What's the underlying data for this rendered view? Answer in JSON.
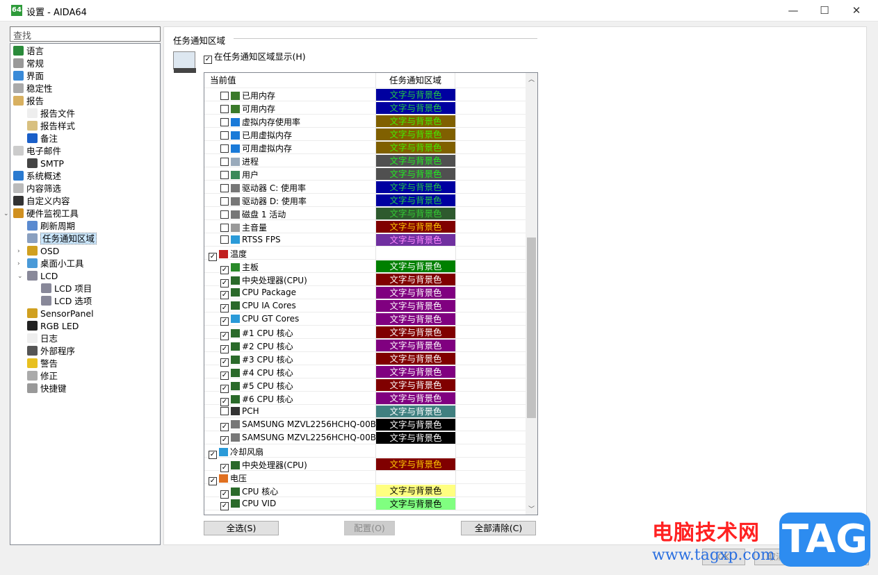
{
  "window": {
    "title": "设置 - AIDA64",
    "app_icon": "64",
    "minimize": "—",
    "maximize": "☐",
    "close": "✕"
  },
  "sidebar": {
    "search_placeholder": "查找",
    "items": [
      {
        "label": "语言",
        "level": 0,
        "icon": "globe-icon",
        "color": "#2a8a3a"
      },
      {
        "label": "常规",
        "level": 0,
        "icon": "gear-icon",
        "color": "#999"
      },
      {
        "label": "界面",
        "level": 0,
        "icon": "window-icon",
        "color": "#3a8ad8"
      },
      {
        "label": "稳定性",
        "level": 0,
        "icon": "gears-icon",
        "color": "#aaa"
      },
      {
        "label": "报告",
        "level": 0,
        "icon": "report-icon",
        "color": "#d8b060"
      },
      {
        "label": "报告文件",
        "level": 1,
        "icon": "file-icon",
        "color": "#eee"
      },
      {
        "label": "报告样式",
        "level": 1,
        "icon": "edit-icon",
        "color": "#d8c080"
      },
      {
        "label": "备注",
        "level": 1,
        "icon": "info-icon",
        "color": "#1a5fc8"
      },
      {
        "label": "电子邮件",
        "level": 0,
        "icon": "mail-icon",
        "color": "#ccc"
      },
      {
        "label": "SMTP",
        "level": 1,
        "icon": "phone-icon",
        "color": "#444"
      },
      {
        "label": "系统概述",
        "level": 0,
        "icon": "monitor-icon",
        "color": "#2a7ad0"
      },
      {
        "label": "内容筛选",
        "level": 0,
        "icon": "filter-icon",
        "color": "#bbb"
      },
      {
        "label": "自定义内容",
        "level": 0,
        "icon": "phone-icon",
        "color": "#333"
      },
      {
        "label": "硬件监视工具",
        "level": 0,
        "icon": "gauge-icon",
        "color": "#d09020",
        "expander": "⌄"
      },
      {
        "label": "刷新周期",
        "level": 1,
        "icon": "clock-icon",
        "color": "#5a8ad0"
      },
      {
        "label": "任务通知区域",
        "level": 1,
        "icon": "tray-icon",
        "color": "#8aa0c0",
        "selected": true
      },
      {
        "label": "OSD",
        "level": 1,
        "icon": "gauge-icon",
        "color": "#d0a020",
        "expander": "›"
      },
      {
        "label": "桌面小工具",
        "level": 1,
        "icon": "gadget-icon",
        "color": "#4a9ad8",
        "expander": "›"
      },
      {
        "label": "LCD",
        "level": 1,
        "icon": "lcd-icon",
        "color": "#889",
        "expander": "⌄"
      },
      {
        "label": "LCD 项目",
        "level": 2,
        "icon": "lcd-icon",
        "color": "#889"
      },
      {
        "label": "LCD 选项",
        "level": 2,
        "icon": "lcd-icon",
        "color": "#889"
      },
      {
        "label": "SensorPanel",
        "level": 1,
        "icon": "gauge-icon",
        "color": "#d0a020"
      },
      {
        "label": "RGB LED",
        "level": 1,
        "icon": "rgb-icon",
        "color": "#222"
      },
      {
        "label": "日志",
        "level": 1,
        "icon": "log-icon",
        "color": "#eee"
      },
      {
        "label": "外部程序",
        "level": 1,
        "icon": "program-icon",
        "color": "#555"
      },
      {
        "label": "警告",
        "level": 1,
        "icon": "warning-icon",
        "color": "#e8c020"
      },
      {
        "label": "修正",
        "level": 1,
        "icon": "correct-icon",
        "color": "#aaa"
      },
      {
        "label": "快捷键",
        "level": 1,
        "icon": "keyboard-icon",
        "color": "#999"
      }
    ]
  },
  "panel": {
    "group_title": "任务通知区域",
    "show_checkbox": {
      "label": "在任务通知区域显示(H)",
      "checked": true
    },
    "columns": [
      "当前值",
      "任务通知区域"
    ],
    "rows": [
      {
        "label": "已用内存",
        "level": 1,
        "checked": false,
        "icon": "memory-icon",
        "icolor": "#3a7a2a",
        "cell": "文字与背景色",
        "bg": "#0000a0",
        "fg": "#22cc44"
      },
      {
        "label": "可用内存",
        "level": 1,
        "checked": false,
        "icon": "memory-icon",
        "icolor": "#3a7a2a",
        "cell": "文字与背景色",
        "bg": "#0000a0",
        "fg": "#22cc44"
      },
      {
        "label": "虚拟内存使用率",
        "level": 1,
        "checked": false,
        "icon": "windows-icon",
        "icolor": "#1a7ad8",
        "cell": "文字与背景色",
        "bg": "#806000",
        "fg": "#44ee00"
      },
      {
        "label": "已用虚拟内存",
        "level": 1,
        "checked": false,
        "icon": "windows-icon",
        "icolor": "#1a7ad8",
        "cell": "文字与背景色",
        "bg": "#806000",
        "fg": "#44ee00"
      },
      {
        "label": "可用虚拟内存",
        "level": 1,
        "checked": false,
        "icon": "windows-icon",
        "icolor": "#1a7ad8",
        "cell": "文字与背景色",
        "bg": "#806000",
        "fg": "#44ee00"
      },
      {
        "label": "进程",
        "level": 1,
        "checked": false,
        "icon": "process-icon",
        "icolor": "#9ab",
        "cell": "文字与背景色",
        "bg": "#505050",
        "fg": "#22ee22"
      },
      {
        "label": "用户",
        "level": 1,
        "checked": false,
        "icon": "user-icon",
        "icolor": "#3a8a5a",
        "cell": "文字与背景色",
        "bg": "#505050",
        "fg": "#22ee22"
      },
      {
        "label": "驱动器 C: 使用率",
        "level": 1,
        "checked": false,
        "icon": "drive-icon",
        "icolor": "#777",
        "cell": "文字与背景色",
        "bg": "#0000a0",
        "fg": "#22cc44"
      },
      {
        "label": "驱动器 D: 使用率",
        "level": 1,
        "checked": false,
        "icon": "drive-icon",
        "icolor": "#777",
        "cell": "文字与背景色",
        "bg": "#0000a0",
        "fg": "#22cc44"
      },
      {
        "label": "磁盘 1 活动",
        "level": 1,
        "checked": false,
        "icon": "drive-icon",
        "icolor": "#777",
        "cell": "文字与背景色",
        "bg": "#2e5a2e",
        "fg": "#33cc33"
      },
      {
        "label": "主音量",
        "level": 1,
        "checked": false,
        "icon": "speaker-icon",
        "icolor": "#999",
        "cell": "文字与背景色",
        "bg": "#800000",
        "fg": "#ffcc00"
      },
      {
        "label": "RTSS FPS",
        "level": 1,
        "checked": false,
        "icon": "monitor-icon",
        "icolor": "#2a9ad8",
        "cell": "文字与背景色",
        "bg": "#7030a0",
        "fg": "#ff88ff"
      },
      {
        "label": "温度",
        "level": 0,
        "checked": true,
        "icon": "thermometer-icon",
        "icolor": "#c02020"
      },
      {
        "label": "主板",
        "level": 1,
        "checked": true,
        "icon": "motherboard-icon",
        "icolor": "#2a8a2a",
        "cell": "文字与背景色",
        "bg": "#008000",
        "fg": "#ffffff"
      },
      {
        "label": "中央处理器(CPU)",
        "level": 1,
        "checked": true,
        "icon": "cpu-icon",
        "icolor": "#2a6a2a",
        "cell": "文字与背景色",
        "bg": "#800000",
        "fg": "#ffffff"
      },
      {
        "label": "CPU Package",
        "level": 1,
        "checked": true,
        "icon": "cpu-icon",
        "icolor": "#2a6a2a",
        "cell": "文字与背景色",
        "bg": "#800080",
        "fg": "#ffffff"
      },
      {
        "label": "CPU IA Cores",
        "level": 1,
        "checked": true,
        "icon": "cpu-icon",
        "icolor": "#2a6a2a",
        "cell": "文字与背景色",
        "bg": "#800080",
        "fg": "#ffffff"
      },
      {
        "label": "CPU GT Cores",
        "level": 1,
        "checked": true,
        "icon": "gpu-icon",
        "icolor": "#2a9ad8",
        "cell": "文字与背景色",
        "bg": "#800080",
        "fg": "#ffffff"
      },
      {
        "label": "#1 CPU 核心",
        "level": 1,
        "checked": true,
        "icon": "cpu-icon",
        "icolor": "#2a6a2a",
        "cell": "文字与背景色",
        "bg": "#800000",
        "fg": "#ffffff"
      },
      {
        "label": "#2 CPU 核心",
        "level": 1,
        "checked": true,
        "icon": "cpu-icon",
        "icolor": "#2a6a2a",
        "cell": "文字与背景色",
        "bg": "#800080",
        "fg": "#ffffff"
      },
      {
        "label": "#3 CPU 核心",
        "level": 1,
        "checked": true,
        "icon": "cpu-icon",
        "icolor": "#2a6a2a",
        "cell": "文字与背景色",
        "bg": "#800000",
        "fg": "#ffffff"
      },
      {
        "label": "#4 CPU 核心",
        "level": 1,
        "checked": true,
        "icon": "cpu-icon",
        "icolor": "#2a6a2a",
        "cell": "文字与背景色",
        "bg": "#800080",
        "fg": "#ffffff"
      },
      {
        "label": "#5 CPU 核心",
        "level": 1,
        "checked": true,
        "icon": "cpu-icon",
        "icolor": "#2a6a2a",
        "cell": "文字与背景色",
        "bg": "#800000",
        "fg": "#ffffff"
      },
      {
        "label": "#6 CPU 核心",
        "level": 1,
        "checked": true,
        "icon": "cpu-icon",
        "icolor": "#2a6a2a",
        "cell": "文字与背景色",
        "bg": "#800080",
        "fg": "#ffffff"
      },
      {
        "label": "PCH",
        "level": 1,
        "checked": false,
        "icon": "chip-icon",
        "icolor": "#333",
        "cell": "文字与背景色",
        "bg": "#408080",
        "fg": "#ffffff"
      },
      {
        "label": "SAMSUNG MZVL2256HCHQ-00B00",
        "level": 1,
        "checked": true,
        "icon": "drive-icon",
        "icolor": "#777",
        "cell": "文字与背景色",
        "bg": "#000000",
        "fg": "#ffffff"
      },
      {
        "label": "SAMSUNG MZVL2256HCHQ-00B0...",
        "level": 1,
        "checked": true,
        "icon": "drive-icon",
        "icolor": "#777",
        "cell": "文字与背景色",
        "bg": "#000000",
        "fg": "#ffffff"
      },
      {
        "label": "冷却风扇",
        "level": 0,
        "checked": true,
        "icon": "fan-icon",
        "icolor": "#2a9ad8"
      },
      {
        "label": "中央处理器(CPU)",
        "level": 1,
        "checked": true,
        "icon": "cpu-icon",
        "icolor": "#2a6a2a",
        "cell": "文字与背景色",
        "bg": "#800000",
        "fg": "#ffcc00"
      },
      {
        "label": "电压",
        "level": 0,
        "checked": true,
        "icon": "voltage-icon",
        "icolor": "#e07020"
      },
      {
        "label": "CPU 核心",
        "level": 1,
        "checked": true,
        "icon": "cpu-icon",
        "icolor": "#2a6a2a",
        "cell": "文字与背景色",
        "bg": "#ffff80",
        "fg": "#000000"
      },
      {
        "label": "CPU VID",
        "level": 1,
        "checked": true,
        "icon": "cpu-icon",
        "icolor": "#2a6a2a",
        "cell": "文字与背景色",
        "bg": "#80ff80",
        "fg": "#000000"
      }
    ],
    "buttons": {
      "select_all": "全选(S)",
      "configure": "配置(O)",
      "clear_all": "全部清除(C)"
    }
  },
  "footer": {
    "ok": "OK",
    "cancel": "取消",
    "apply": "应用"
  },
  "watermark": {
    "site_name": "电脑技术网",
    "url": "www.tagxp.com",
    "logo": "TAG"
  }
}
